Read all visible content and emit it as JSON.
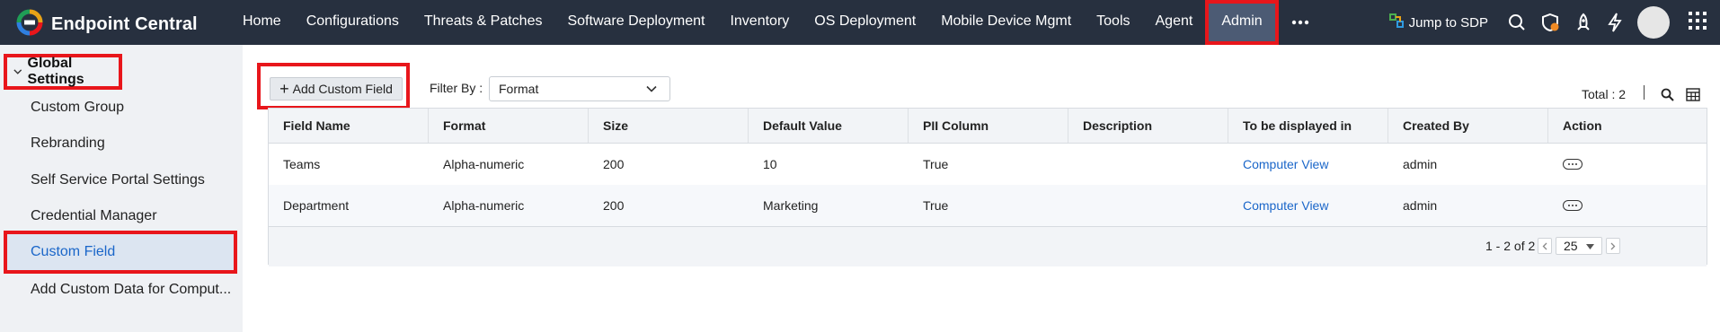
{
  "app": {
    "title": "Endpoint Central"
  },
  "nav": {
    "items": [
      "Home",
      "Configurations",
      "Threats & Patches",
      "Software Deployment",
      "Inventory",
      "OS Deployment",
      "Mobile Device Mgmt",
      "Tools",
      "Agent",
      "Admin"
    ],
    "active": "Admin",
    "jump_label": "Jump to SDP"
  },
  "icons": {
    "brand": "endpoint-central-logo",
    "more": "more-dots-icon",
    "jump": "sdp-icon",
    "search": "search-icon",
    "shield": "shield-icon",
    "rocket": "rocket-icon",
    "bolt": "bolt-icon",
    "avatar": "user-avatar",
    "apps": "app-grid-icon"
  },
  "colors": {
    "topbar": "#27303f",
    "active_nav": "#4c5b74",
    "highlight": "#e8161b",
    "link": "#1a66c9"
  },
  "sidebar": {
    "section": "Global Settings",
    "items": [
      "Custom Group",
      "Rebranding",
      "Self Service Portal Settings",
      "Credential Manager",
      "Custom Field",
      "Add Custom Data for Comput..."
    ],
    "active": "Custom Field"
  },
  "toolbar": {
    "add_label": "Add Custom Field",
    "filter_label": "Filter By :",
    "filter_value": "Format",
    "total_label": "Total : 2"
  },
  "table": {
    "columns": [
      "Field Name",
      "Format",
      "Size",
      "Default Value",
      "PII Column",
      "Description",
      "To be displayed in",
      "Created By",
      "Action"
    ],
    "rows": [
      {
        "field_name": "Teams",
        "format": "Alpha-numeric",
        "size": "200",
        "default_value": "10",
        "pii": "True",
        "description": "",
        "displayed_in": "Computer View",
        "created_by": "admin"
      },
      {
        "field_name": "Department",
        "format": "Alpha-numeric",
        "size": "200",
        "default_value": "Marketing",
        "pii": "True",
        "description": "",
        "displayed_in": "Computer View",
        "created_by": "admin"
      }
    ]
  },
  "pagination": {
    "range": "1 - 2 of 2",
    "per_page": "25"
  }
}
